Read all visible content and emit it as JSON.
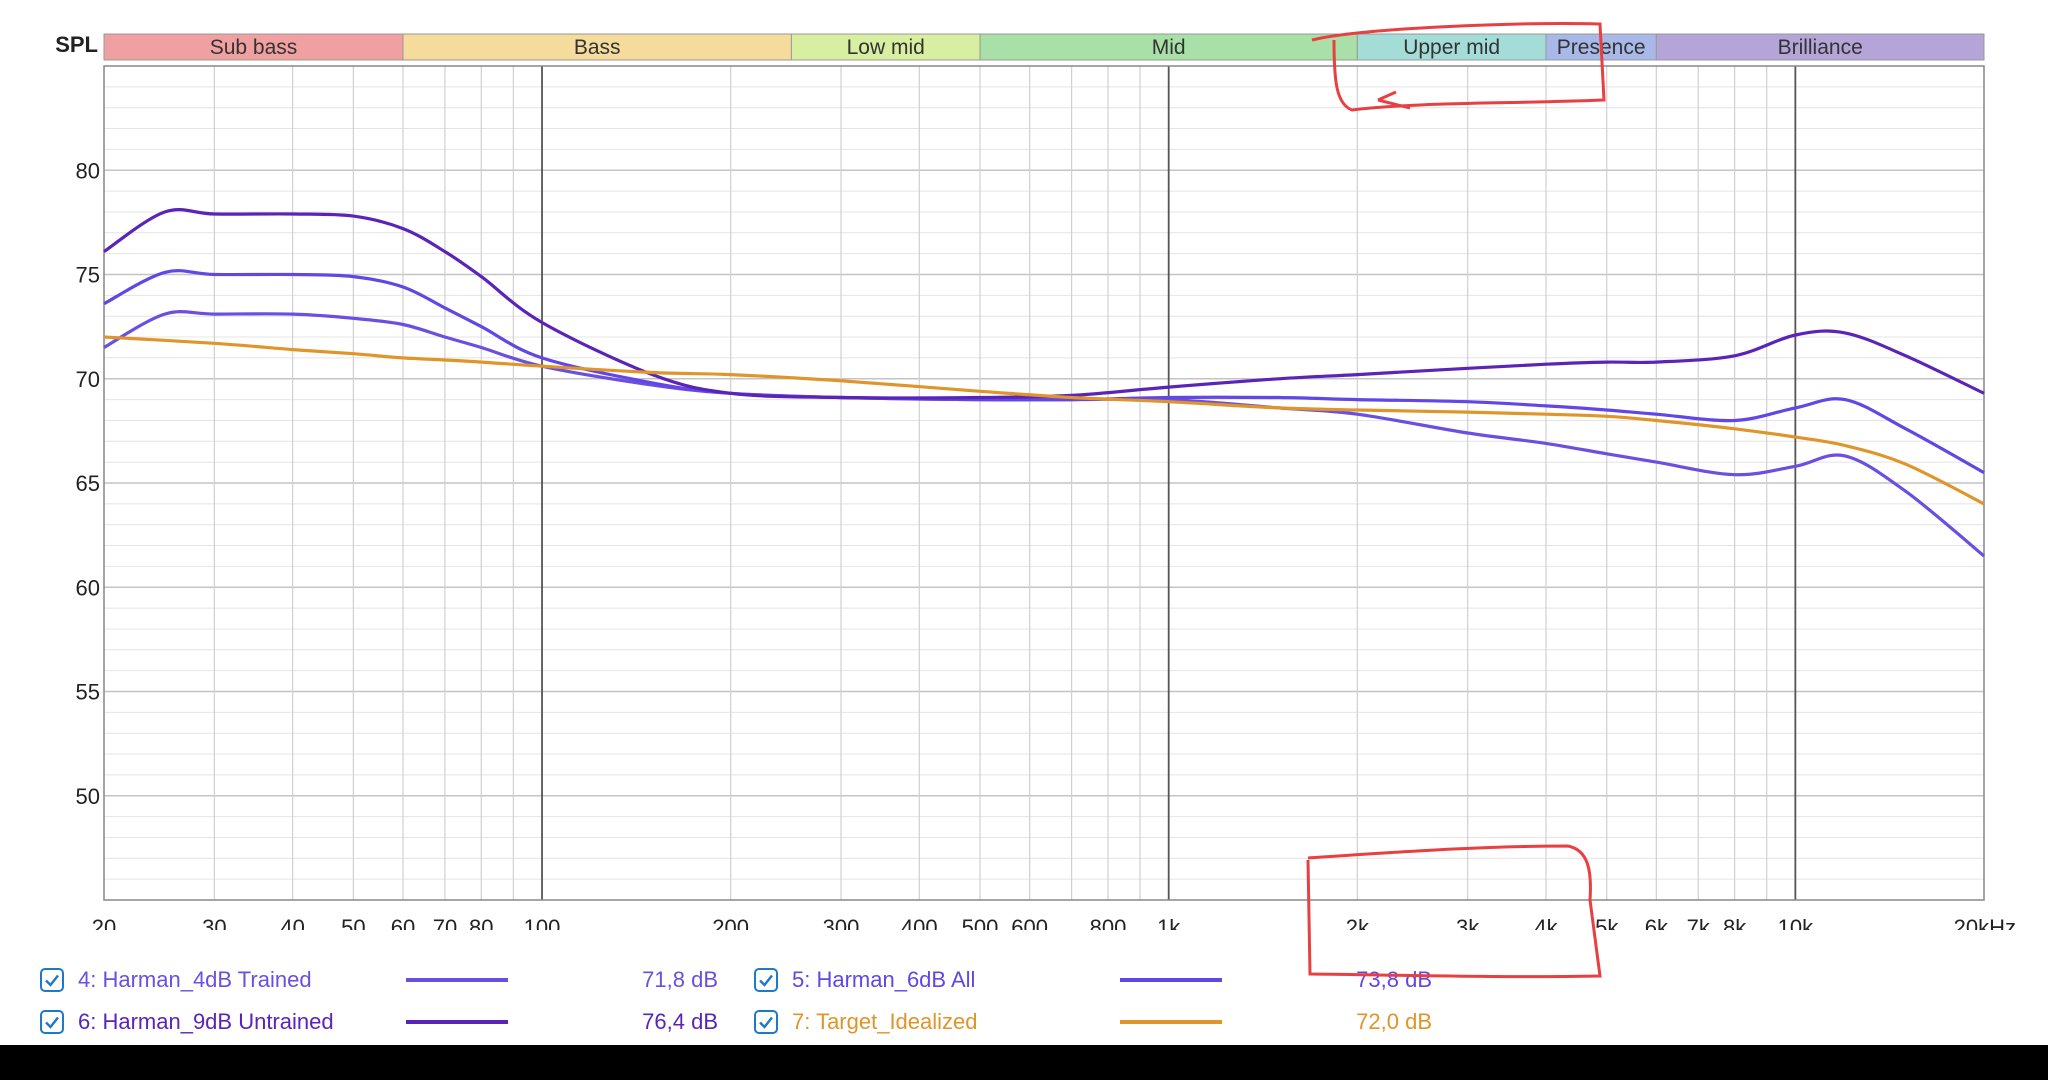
{
  "chart_data": {
    "type": "line",
    "ylabel": "SPL",
    "x_unit_label": "20kHz",
    "xscale": "log",
    "xlim": [
      20,
      20000
    ],
    "ylim": [
      45,
      85
    ],
    "y_ticks": [
      50,
      55,
      60,
      65,
      70,
      75,
      80
    ],
    "x_ticks": [
      {
        "v": 20,
        "label": "20"
      },
      {
        "v": 30,
        "label": "30"
      },
      {
        "v": 40,
        "label": "40"
      },
      {
        "v": 50,
        "label": "50"
      },
      {
        "v": 60,
        "label": "60"
      },
      {
        "v": 70,
        "label": "70"
      },
      {
        "v": 80,
        "label": "80"
      },
      {
        "v": 100,
        "label": "100"
      },
      {
        "v": 200,
        "label": "200"
      },
      {
        "v": 300,
        "label": "300"
      },
      {
        "v": 400,
        "label": "400"
      },
      {
        "v": 500,
        "label": "500"
      },
      {
        "v": 600,
        "label": "600"
      },
      {
        "v": 800,
        "label": "800"
      },
      {
        "v": 1000,
        "label": "1k"
      },
      {
        "v": 2000,
        "label": "2k"
      },
      {
        "v": 3000,
        "label": "3k"
      },
      {
        "v": 4000,
        "label": "4k"
      },
      {
        "v": 5000,
        "label": "5k"
      },
      {
        "v": 6000,
        "label": "6k"
      },
      {
        "v": 7000,
        "label": "7k"
      },
      {
        "v": 8000,
        "label": "8k"
      },
      {
        "v": 10000,
        "label": "10k"
      },
      {
        "v": 20000,
        "label": "20kHz"
      }
    ],
    "grid": true,
    "bands": [
      {
        "label": "Sub bass",
        "from": 20,
        "to": 60,
        "color": "#f0a0a0"
      },
      {
        "label": "Bass",
        "from": 60,
        "to": 250,
        "color": "#f5dc9c"
      },
      {
        "label": "Low mid",
        "from": 250,
        "to": 500,
        "color": "#d8eea0"
      },
      {
        "label": "Mid",
        "from": 500,
        "to": 2000,
        "color": "#a8e0a8"
      },
      {
        "label": "Upper mid",
        "from": 2000,
        "to": 4000,
        "color": "#a4dcd8"
      },
      {
        "label": "Presence",
        "from": 4000,
        "to": 6000,
        "color": "#a8b8e8"
      },
      {
        "label": "Brilliance",
        "from": 6000,
        "to": 20000,
        "color": "#b4a4d8"
      }
    ],
    "series": [
      {
        "id": "s4",
        "name": "4: Harman_4dB Trained",
        "value": "71,8 dB",
        "color": "#6a4fe0",
        "x": [
          20,
          25,
          30,
          40,
          50,
          60,
          70,
          80,
          100,
          150,
          200,
          300,
          500,
          700,
          1000,
          1500,
          2000,
          3000,
          4000,
          5000,
          6000,
          8000,
          10000,
          12000,
          15000,
          20000
        ],
        "y": [
          71.5,
          73.1,
          73.1,
          73.1,
          72.9,
          72.6,
          72.0,
          71.5,
          70.6,
          69.7,
          69.3,
          69.1,
          69.0,
          69.0,
          69.0,
          68.6,
          68.3,
          67.4,
          66.9,
          66.4,
          66.0,
          65.4,
          65.8,
          66.3,
          64.6,
          61.5
        ]
      },
      {
        "id": "s5",
        "name": "5: Harman_6dB All",
        "value": "73,8 dB",
        "color": "#6246e6",
        "x": [
          20,
          25,
          30,
          40,
          50,
          60,
          70,
          80,
          100,
          150,
          200,
          300,
          500,
          700,
          1000,
          1500,
          2000,
          3000,
          4000,
          5000,
          6000,
          8000,
          10000,
          12000,
          15000,
          20000
        ],
        "y": [
          73.6,
          75.1,
          75.0,
          75.0,
          74.9,
          74.4,
          73.4,
          72.5,
          71.0,
          69.8,
          69.3,
          69.1,
          69.0,
          69.0,
          69.1,
          69.1,
          69.0,
          68.9,
          68.7,
          68.5,
          68.3,
          68.0,
          68.6,
          69.0,
          67.6,
          65.5
        ]
      },
      {
        "id": "s6",
        "name": "6: Harman_9dB Untrained",
        "value": "76,4 dB",
        "color": "#5b24b8",
        "x": [
          20,
          25,
          30,
          40,
          50,
          60,
          70,
          80,
          100,
          150,
          200,
          300,
          500,
          700,
          1000,
          1500,
          2000,
          3000,
          4000,
          5000,
          6000,
          8000,
          10000,
          12000,
          15000,
          20000
        ],
        "y": [
          76.1,
          78.0,
          77.9,
          77.9,
          77.8,
          77.2,
          76.1,
          74.9,
          72.7,
          70.2,
          69.3,
          69.1,
          69.1,
          69.2,
          69.6,
          70.0,
          70.2,
          70.5,
          70.7,
          70.8,
          70.8,
          71.1,
          72.1,
          72.2,
          71.1,
          69.3
        ]
      },
      {
        "id": "s7",
        "name": "7: Target_Idealized",
        "value": "72,0 dB",
        "color": "#e0952a",
        "x": [
          20,
          30,
          40,
          50,
          60,
          70,
          80,
          100,
          150,
          200,
          300,
          500,
          700,
          1000,
          1500,
          2000,
          3000,
          4000,
          5000,
          6000,
          8000,
          10000,
          12000,
          15000,
          20000
        ],
        "y": [
          72.0,
          71.7,
          71.4,
          71.2,
          71.0,
          70.9,
          70.8,
          70.6,
          70.3,
          70.2,
          69.9,
          69.4,
          69.1,
          68.9,
          68.6,
          68.5,
          68.4,
          68.3,
          68.2,
          68.0,
          67.6,
          67.2,
          66.8,
          65.9,
          64.0
        ]
      }
    ]
  },
  "legend": [
    {
      "name": "4: Harman_4dB Trained",
      "value": "71,8 dB",
      "checked": true
    },
    {
      "name": "5: Harman_6dB All",
      "value": "73,8 dB",
      "checked": true
    },
    {
      "name": "6: Harman_9dB Untrained",
      "value": "76,4 dB",
      "checked": true
    },
    {
      "name": "7: Target_Idealized",
      "value": "72,0 dB",
      "checked": true
    }
  ],
  "annotation_color": "#e83030"
}
